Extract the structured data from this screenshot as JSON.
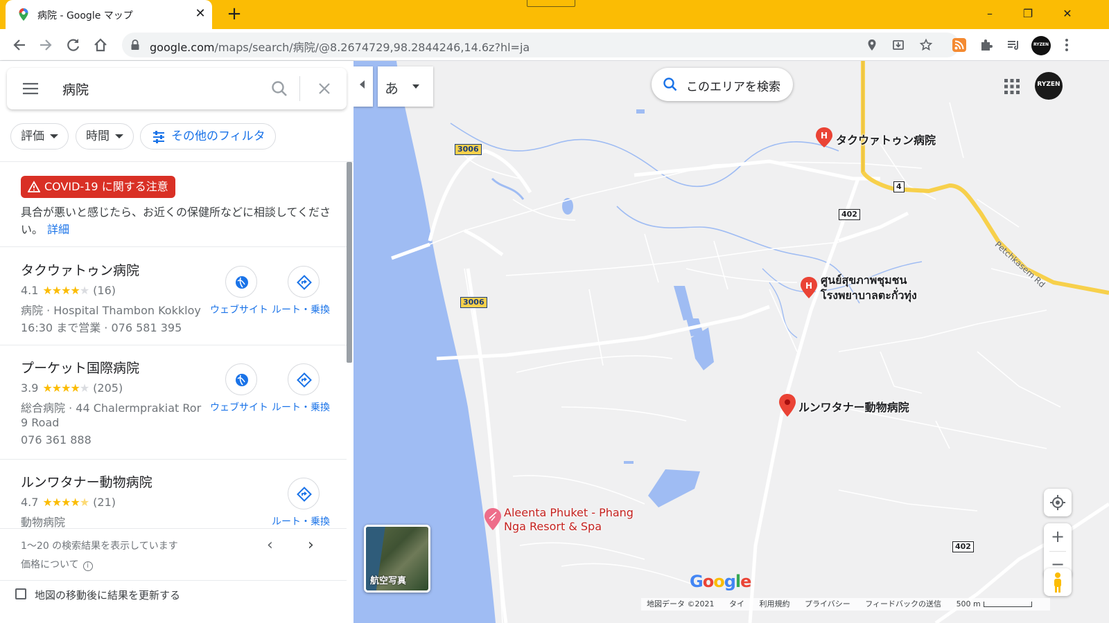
{
  "browser": {
    "tab_title": "病院 - Google マップ",
    "new_tab": "+",
    "url_host": "google.com",
    "url_path": "/maps/search/病院/@8.2674729,98.2844246,14.6z?hl=ja",
    "window_controls": {
      "minimize": "–",
      "maximize": "❐",
      "close": "✕"
    },
    "profile_badge": "RYZEN"
  },
  "search": {
    "query": "病院",
    "filters": [
      "評価",
      "時間"
    ],
    "more_filters": "その他のフィルタ"
  },
  "covid": {
    "badge": "COVID-19 に関する注意",
    "text": "具合が悪いと感じたら、お近くの保健所などに相談してください。",
    "link": "詳細"
  },
  "results": [
    {
      "name": "タクウァトゥン病院",
      "rating": "4.1",
      "stars": 4.0,
      "reviews": "(16)",
      "lines": [
        "病院 · Hospital Thambon Kokkloy",
        "16:30 まで営業 · 076 581 395"
      ],
      "actions": [
        "ウェブサイト",
        "ルート・乗換"
      ]
    },
    {
      "name": "プーケット国際病院",
      "rating": "3.9",
      "stars": 4.0,
      "reviews": "(205)",
      "lines": [
        "総合病院 · 44 Chalermprakiat Ror",
        "9 Road",
        "076 361 888"
      ],
      "actions": [
        "ウェブサイト",
        "ルート・乗換"
      ]
    },
    {
      "name": "ルンワタナー動物病院",
      "rating": "4.7",
      "stars": 4.5,
      "reviews": "(21)",
      "lines": [
        "動物病院"
      ],
      "actions": [
        "ルート・乗換"
      ]
    }
  ],
  "footer": {
    "results_count": "1〜20 の検索結果を表示しています",
    "pricing": "価格について",
    "update_on_move": "地図の移動後に結果を更新する"
  },
  "map": {
    "ime_label": "あ",
    "search_area": "このエリアを検索",
    "places": {
      "hospital_1": "タクウァトゥン病院",
      "hospital_2_line1": "ศูนย์สุขภาพชุมชน",
      "hospital_2_line2": "โรงพยาบาลตะกั่วทุ่ง",
      "vet": "ルンワタナー動物病院",
      "resort_line1": "Aleenta Phuket - Phang",
      "resort_line2": "Nga Resort & Spa"
    },
    "shields": {
      "r3006_a": "3006",
      "r3006_b": "3006",
      "r4": "4",
      "r402_a": "402",
      "r402_b": "402"
    },
    "road_name": "Petchkasem Rd",
    "aerial_label": "航空写真",
    "logo": "Google",
    "footer": {
      "map_data": "地図データ ©2021",
      "country": "タイ",
      "terms": "利用規約",
      "privacy": "プライバシー",
      "feedback": "フィードバックの送信",
      "scale": "500 m"
    },
    "colors": {
      "water": "#9fbcf3",
      "highway": "#f7d04b",
      "pin": "#ea4335"
    }
  }
}
